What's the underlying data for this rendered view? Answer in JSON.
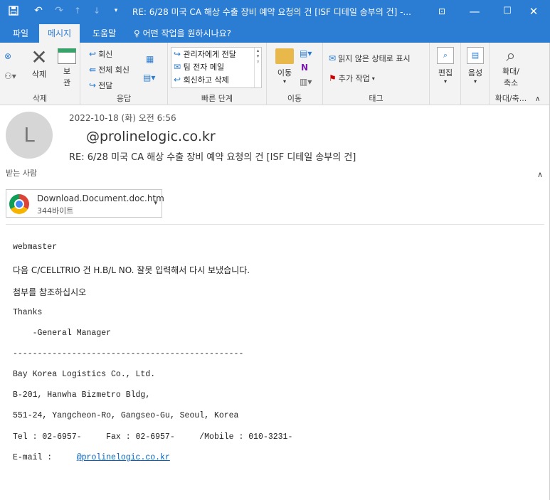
{
  "titlebar": {
    "title": "RE: 6/28 미국 CA 해상 수출 장비 예약 요청의 건 [ISF 디테일 송부의 건]  -...",
    "icons": [
      "save-icon",
      "undo-icon",
      "redo-icon",
      "up-icon",
      "down-icon",
      "more-icon"
    ],
    "controls": [
      "ribbon-display-icon",
      "minimize-icon",
      "maximize-icon",
      "close-icon"
    ]
  },
  "tabs": {
    "file": "파일",
    "message": "메시지",
    "help": "도움말",
    "tell_me": "어떤 작업을 원하시나요?"
  },
  "ribbon": {
    "delete_group": {
      "label": "삭제",
      "delete": "삭제",
      "archive_a": "보",
      "archive_b": "관"
    },
    "respond_group": {
      "label": "응답",
      "reply": "회신",
      "reply_all": "전체 회신",
      "forward": "전달"
    },
    "quick_steps_group": {
      "label": "빠른 단계",
      "items": [
        "관리자에게 전달",
        "팀 전자 메일",
        "회신하고 삭제"
      ]
    },
    "move_group": {
      "label": "이동",
      "move": "이동"
    },
    "tags_group": {
      "label": "태그",
      "mark_unread": "읽지 않은 상태로 표시",
      "follow_up": "추가 작업"
    },
    "edit": "편집",
    "voice": "음성",
    "zoom_group": {
      "label": "확대/축...",
      "zoom_a": "확대/",
      "zoom_b": "축소"
    }
  },
  "message": {
    "avatar_initial": "L",
    "date": "2022-10-18 (화) 오전 6:56",
    "sender": "@prolinelogic.co.kr",
    "subject": "RE: 6/28 미국 CA 해상 수출 장비 예약 요청의 건 [ISF 디테일 송부의 건]",
    "to_label": "받는 사람"
  },
  "attachment": {
    "name": "Download.Document.doc.htm",
    "size": "344바이트"
  },
  "body": {
    "lines": [
      "webmaster",
      "다음 C/CELLTRIO 건 H.B/L NO. 잘못 입력해서 다시 보냈습니다.",
      "첨부를 참조하십시오",
      "Thanks",
      "    -General Manager",
      "-----------------------------------------------",
      "Bay Korea Logistics Co., Ltd.",
      "B-201, Hanwha Bizmetro Bldg,",
      "551-24, Yangcheon-Ro, Gangseo-Gu, Seoul, Korea",
      "Tel : 02-6957-     Fax : 02-6957-     /Mobile : 010-3231-"
    ],
    "email_label": "E-mail :",
    "email_link": "@prolinelogic.co.kr"
  }
}
